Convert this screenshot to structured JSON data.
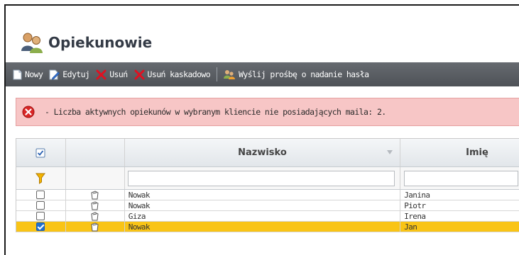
{
  "page": {
    "title": "Opiekunowie",
    "title_icon": "users-icon"
  },
  "toolbar": {
    "new_label": "Nowy",
    "edit_label": "Edytuj",
    "delete_label": "Usuń",
    "cascade_delete_label": "Usuń kaskadowo",
    "send_password_label": "Wyślij prośbę o nadanie hasła"
  },
  "alert": {
    "icon": "error-icon",
    "message": "- Liczba aktywnych opiekunów w wybranym kliencie nie posiadających maila: 2."
  },
  "grid": {
    "columns": {
      "surname": "Nazwisko",
      "name": "Imię"
    },
    "filters": {
      "surname": "",
      "name": ""
    },
    "rows": [
      {
        "surname": "Nowak",
        "name": "Janina",
        "checked": false,
        "selected": false
      },
      {
        "surname": "Nowak",
        "name": "Piotr",
        "checked": false,
        "selected": false
      },
      {
        "surname": "Giza",
        "name": "Irena",
        "checked": false,
        "selected": false
      },
      {
        "surname": "Nowak",
        "name": "Jan",
        "checked": true,
        "selected": true
      }
    ]
  },
  "colors": {
    "toolbar": "#55595e",
    "alert_bg": "#f7c6c6",
    "selected_row": "#f9c416",
    "delete_icon": "#d0021b"
  }
}
